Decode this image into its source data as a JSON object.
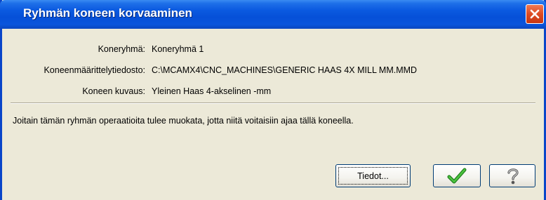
{
  "dialog": {
    "title": "Ryhmän koneen korvaaminen"
  },
  "info": {
    "machine_group": {
      "label": "Koneryhmä:",
      "value": "Koneryhmä 1"
    },
    "machine_file": {
      "label": "Koneenmäärittelytiedosto:",
      "value": "C:\\MCAMX4\\CNC_MACHINES\\GENERIC HAAS 4X MILL MM.MMD"
    },
    "machine_desc": {
      "label": "Koneen kuvaus:",
      "value": "Yleinen Haas 4-akselinen -mm"
    }
  },
  "message": "Joitain tämän ryhmän operaatioita tulee muokata, jotta niitä voitaisiin ajaa tällä koneella.",
  "buttons": {
    "details_label": "Tiedot...",
    "ok_icon": "checkmark-icon",
    "help_icon": "question-mark-icon",
    "close_icon": "close-icon"
  },
  "colors": {
    "titlebar": "#0650d8",
    "dialog_bg": "#ece9d8",
    "close_button": "#dd4a22",
    "checkmark": "#2fa12b"
  }
}
